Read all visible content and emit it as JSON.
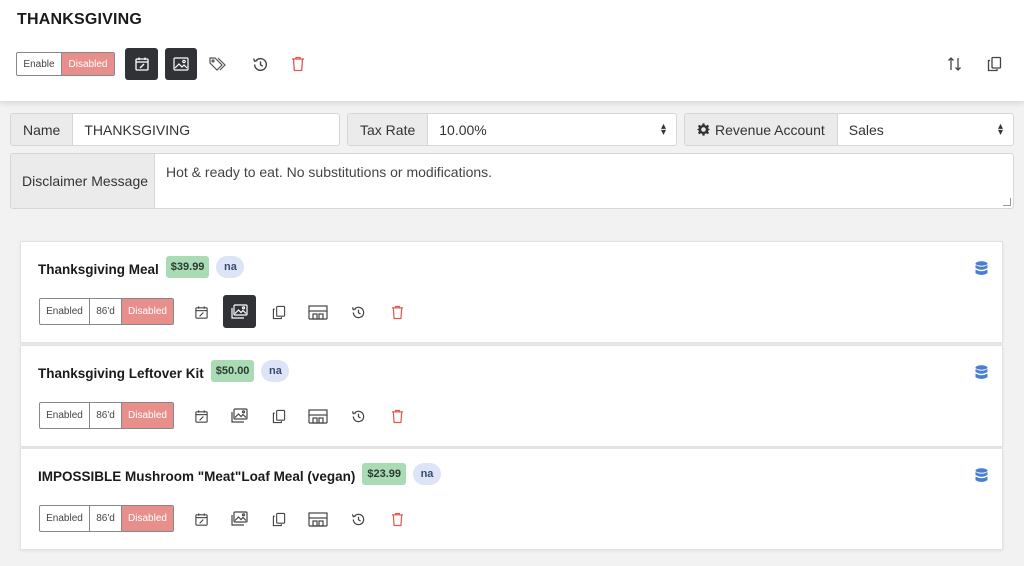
{
  "header": {
    "title": "THANKSGIVING",
    "toggle": {
      "on_label": "Enable",
      "off_label": "Disabled"
    }
  },
  "form": {
    "name": {
      "label": "Name",
      "value": "THANKSGIVING"
    },
    "tax_rate": {
      "label": "Tax Rate",
      "value": "10.00%"
    },
    "revenue_account": {
      "label": "Revenue Account",
      "value": "Sales"
    },
    "disclaimer": {
      "label": "Disclaimer Message",
      "value": "Hot & ready to eat. No substitutions or modifications."
    }
  },
  "items": [
    {
      "name": "Thanksgiving Meal",
      "price": "$39.99",
      "tag": "na",
      "toggle": {
        "enabled": "Enabled",
        "eighty_six": "86'd",
        "disabled": "Disabled"
      },
      "image_active": true
    },
    {
      "name": "Thanksgiving Leftover Kit",
      "price": "$50.00",
      "tag": "na",
      "toggle": {
        "enabled": "Enabled",
        "eighty_six": "86'd",
        "disabled": "Disabled"
      },
      "image_active": false
    },
    {
      "name": "IMPOSSIBLE Mushroom \"Meat\"Loaf Meal (vegan)",
      "price": "$23.99",
      "tag": "na",
      "toggle": {
        "enabled": "Enabled",
        "eighty_six": "86'd",
        "disabled": "Disabled"
      },
      "image_active": false
    }
  ],
  "colors": {
    "disabled_red": "#e88f8b",
    "price_green": "#a9dbb5",
    "tag_blue": "#dde4f7",
    "dark_button": "#303236",
    "trash_red": "#e0584f",
    "db_blue": "#4a7fd0"
  },
  "icons": [
    "calendar-icon",
    "image-icon",
    "tags-icon",
    "history-icon",
    "trash-icon",
    "sort-icon",
    "copy-icon",
    "seating-icon",
    "database-icon",
    "gear-icon",
    "select-arrows-icon"
  ]
}
